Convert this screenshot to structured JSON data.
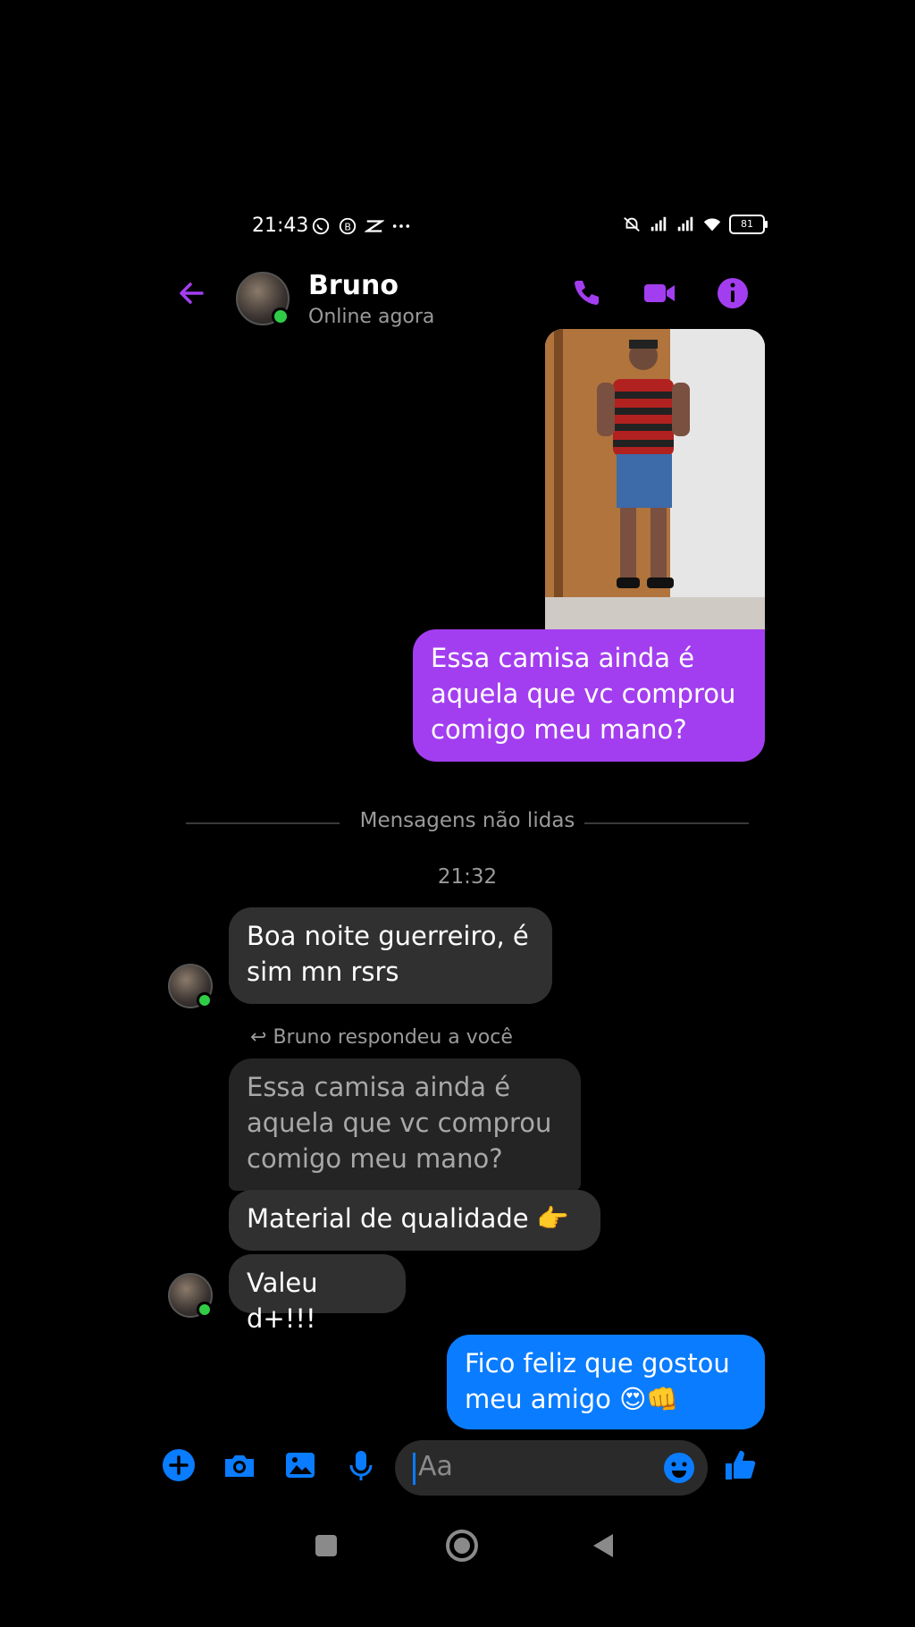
{
  "status_bar": {
    "time": "21:43",
    "battery": "81"
  },
  "header": {
    "contact_name": "Bruno",
    "presence": "Online agora"
  },
  "messages": {
    "sent_1": "Essa camisa ainda é aquela que vc comprou comigo meu mano?",
    "divider_label": "Mensagens não lidas",
    "timestamp": "21:32",
    "recv_1": "Boa noite guerreiro, é sim mn rsrs",
    "reply_note": "Bruno respondeu a você",
    "quoted": "Essa camisa ainda é aquela que vc comprou comigo meu mano?",
    "recv_2": "Material de qualidade 👉",
    "recv_3": "Valeu d+!!!",
    "sent_2": "Fico feliz que gostou meu amigo 😍👊"
  },
  "composer": {
    "placeholder": "Aa"
  },
  "colors": {
    "accent_purple": "#a33ef0",
    "accent_blue": "#0a7cff",
    "online_green": "#31cc46"
  }
}
